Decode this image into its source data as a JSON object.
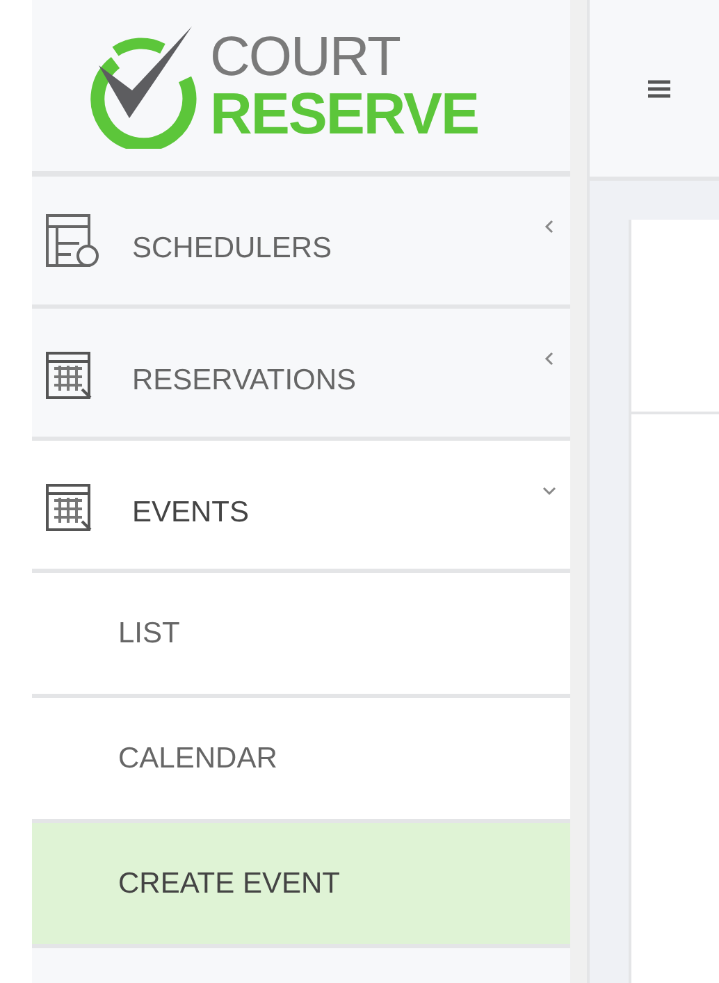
{
  "logo": {
    "line_1": "COURT",
    "line_2": "RESERVE"
  },
  "sidebar": {
    "items": [
      {
        "label": "SCHEDULERS",
        "kind": "scheduler",
        "expanded": false,
        "selected": false
      },
      {
        "label": "RESERVATIONS",
        "kind": "calendar",
        "expanded": false,
        "selected": false
      },
      {
        "label": "EVENTS",
        "kind": "calendar",
        "expanded": true,
        "selected": false,
        "children": [
          {
            "label": "LIST",
            "selected": false
          },
          {
            "label": "CALENDAR",
            "selected": false
          },
          {
            "label": "CREATE EVENT",
            "selected": true
          }
        ]
      }
    ]
  }
}
